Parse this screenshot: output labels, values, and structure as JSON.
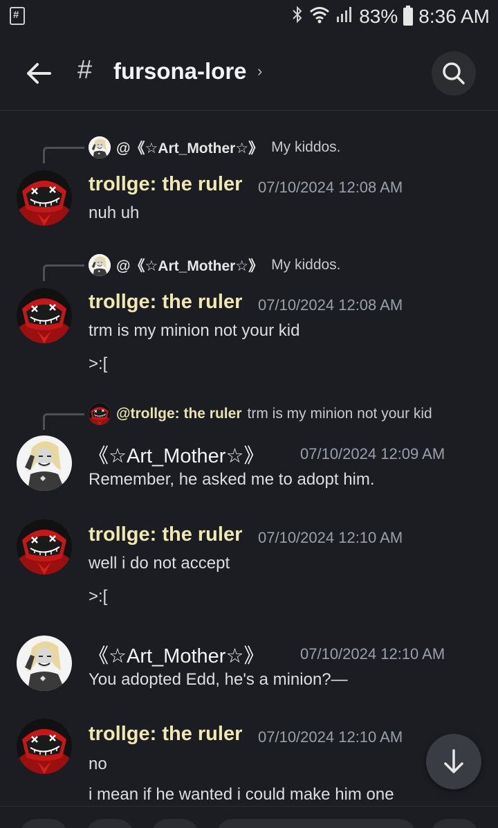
{
  "status": {
    "battery_percent": "83%",
    "time": "8:36 AM",
    "icons": [
      "app-notification-icon",
      "bluetooth-icon",
      "wifi-icon",
      "signal-icon",
      "battery-icon"
    ]
  },
  "header": {
    "channel_prefix": "#",
    "channel_name": "fursona-lore",
    "chevron": "›"
  },
  "messages": [
    {
      "reply": {
        "author": "@《☆Art_Mother☆》",
        "text": "My kiddos."
      },
      "author": "trollge: the ruler",
      "timestamp": "07/10/2024 12:08 AM",
      "lines": [
        "nuh uh"
      ]
    },
    {
      "reply": {
        "author": "@《☆Art_Mother☆》",
        "text": "My kiddos."
      },
      "author": "trollge: the ruler",
      "timestamp": "07/10/2024 12:08 AM",
      "lines": [
        "trm is my minion not your kid",
        ">:["
      ]
    },
    {
      "reply": {
        "author": "@trollge: the ruler",
        "text": "trm is my minion not your kid"
      },
      "author": "《☆Art_Mother☆》",
      "timestamp": "07/10/2024 12:09 AM",
      "lines": [
        "Remember, he asked me to adopt him."
      ]
    },
    {
      "author": "trollge: the ruler",
      "timestamp": "07/10/2024 12:10 AM",
      "lines": [
        "well i do not accept",
        ">:["
      ]
    },
    {
      "author": "《☆Art_Mother☆》",
      "timestamp": "07/10/2024 12:10 AM",
      "lines": [
        "You adopted Edd, he's a minion?—"
      ]
    },
    {
      "author": "trollge: the ruler",
      "timestamp": "07/10/2024 12:10 AM",
      "lines": [
        "no",
        "i mean if he wanted i could make him one"
      ]
    }
  ],
  "colors": {
    "background": "#1c1d22",
    "trollge_name": "#f0e8b0",
    "timestamp": "#9aa0a8"
  }
}
